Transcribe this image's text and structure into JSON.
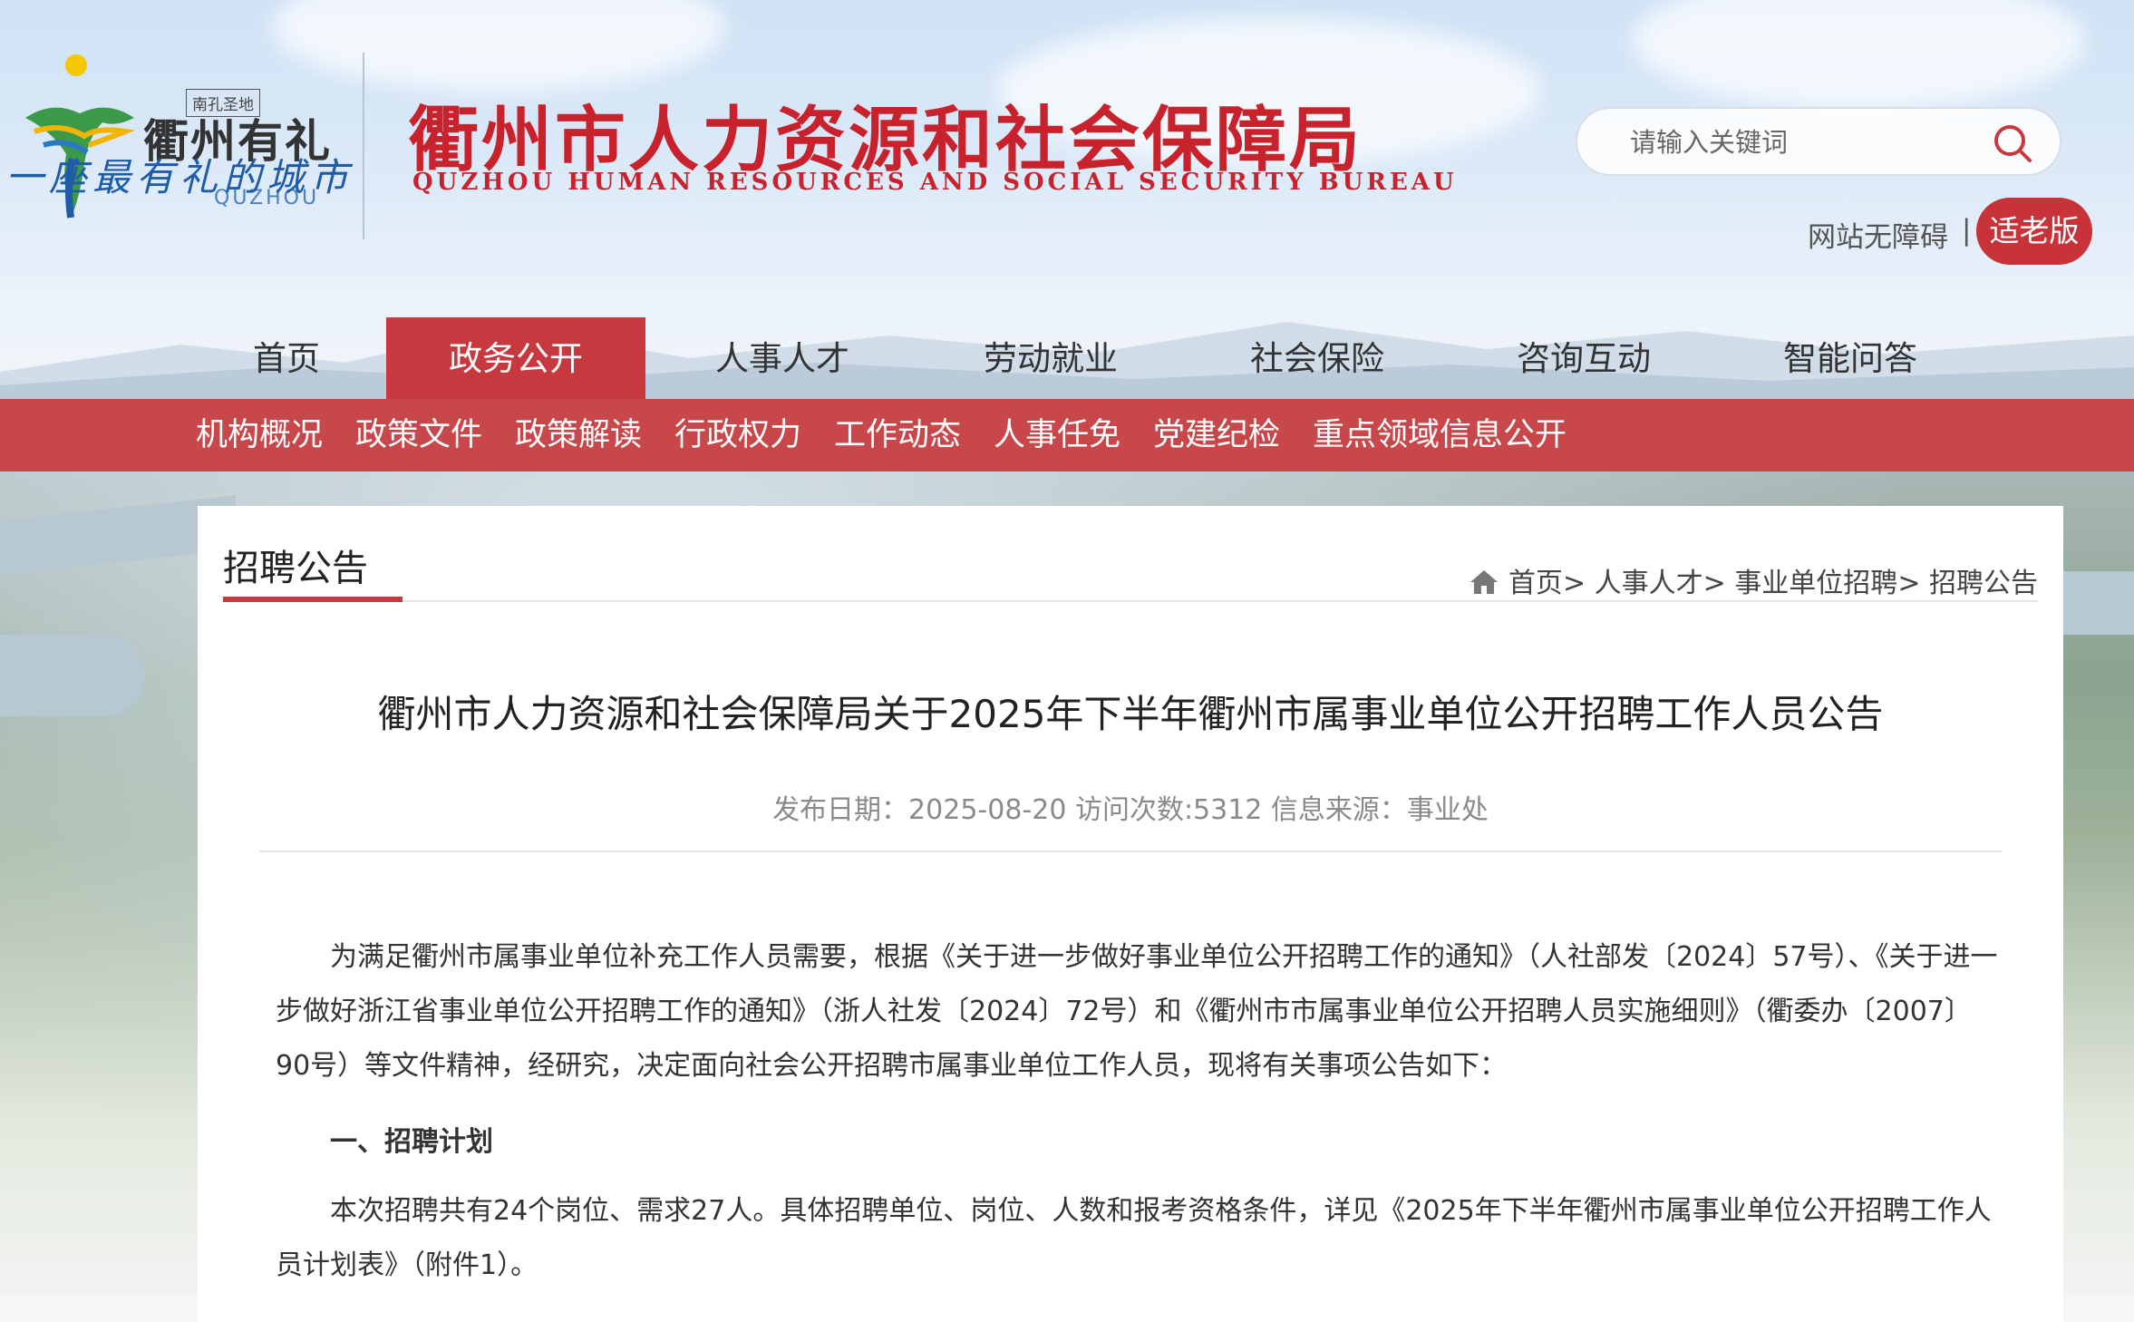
{
  "header": {
    "logo": {
      "seal": "南孔圣地",
      "name": "衢州有礼",
      "name_en": "QUZHOU",
      "slogan": "一座最有礼的城市"
    },
    "site_title": "衢州市人力资源和社会保障局",
    "site_title_en": "QUZHOU HUMAN RESOURCES AND SOCIAL SECURITY BUREAU",
    "search": {
      "placeholder": "请输入关键词",
      "icon": "search-icon"
    },
    "accessibility_label": "网站无障碍",
    "separator": "|",
    "elder_mode_label": "适老版"
  },
  "main_nav": [
    {
      "label": "首页",
      "active": false
    },
    {
      "label": "政务公开",
      "active": true
    },
    {
      "label": "人事人才",
      "active": false
    },
    {
      "label": "劳动就业",
      "active": false
    },
    {
      "label": "社会保险",
      "active": false
    },
    {
      "label": "咨询互动",
      "active": false
    },
    {
      "label": "智能问答",
      "active": false
    }
  ],
  "sub_nav": [
    "机构概况",
    "政策文件",
    "政策解读",
    "行政权力",
    "工作动态",
    "人事任免",
    "党建纪检",
    "重点领域信息公开"
  ],
  "section": {
    "tab_label": "招聘公告",
    "breadcrumb": [
      "首页",
      "人事人才",
      "事业单位招聘",
      "招聘公告"
    ],
    "breadcrumb_sep": ">"
  },
  "article": {
    "title": "衢州市人力资源和社会保障局关于2025年下半年衢州市属事业单位公开招聘工作人员公告",
    "meta": "发布日期：2025-08-20 访问次数:5312 信息来源：事业处",
    "paragraph1": "为满足衢州市属事业单位补充工作人员需要，根据《关于进一步做好事业单位公开招聘工作的通知》（人社部发〔2024〕57号）、《关于进一步做好浙江省事业单位公开招聘工作的通知》（浙人社发〔2024〕72号）和《衢州市市属事业单位公开招聘人员实施细则》（衢委办〔2007〕90号）等文件精神，经研究，决定面向社会公开招聘市属事业单位工作人员，现将有关事项公告如下：",
    "heading1": "一、招聘计划",
    "paragraph2": "本次招聘共有24个岗位、需求27人。具体招聘单位、岗位、人数和报考资格条件，详见《2025年下半年衢州市属事业单位公开招聘工作人员计划表》（附件1）。"
  },
  "colors": {
    "brand_red": "#c8232d",
    "nav_red": "#c8474a",
    "active_tab": "#c8393f",
    "slogan_blue": "#1e5ba8"
  }
}
